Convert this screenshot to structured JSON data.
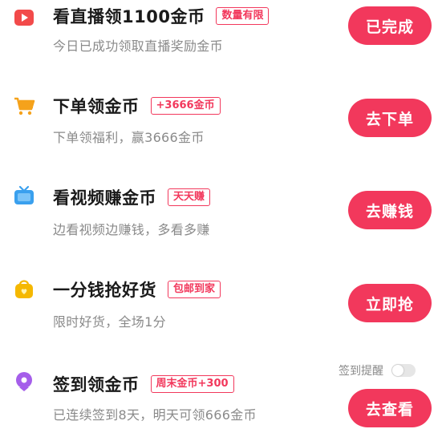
{
  "colors": {
    "accent": "#f2385c",
    "title": "#1a1a1a",
    "subtitle": "#8a8a8a"
  },
  "tasks": [
    {
      "icon": "video-play-icon",
      "title": "看直播领1100金币",
      "badge": "数量有限",
      "subtitle": "今日已成功领取直播奖励金币",
      "button": "已完成"
    },
    {
      "icon": "shopping-cart-icon",
      "title": "下单领金币",
      "badge": "+3666金币",
      "subtitle": "下单领福利，赢3666金币",
      "button": "去下单"
    },
    {
      "icon": "tv-icon",
      "title": "看视频赚金币",
      "badge": "天天赚",
      "subtitle": "边看视频边赚钱，多看多赚",
      "button": "去赚钱"
    },
    {
      "icon": "shopping-bag-icon",
      "title": "一分钱抢好货",
      "badge": "包邮到家",
      "subtitle": "限时好货，全场1分",
      "button": "立即抢"
    },
    {
      "icon": "location-pin-icon",
      "title": "签到领金币",
      "badge": "周末金币+300",
      "subtitle": "已连续签到8天，明天可领666金币",
      "button": "去查看"
    }
  ],
  "checkin_reminder": {
    "label": "签到提醒",
    "enabled": false
  }
}
